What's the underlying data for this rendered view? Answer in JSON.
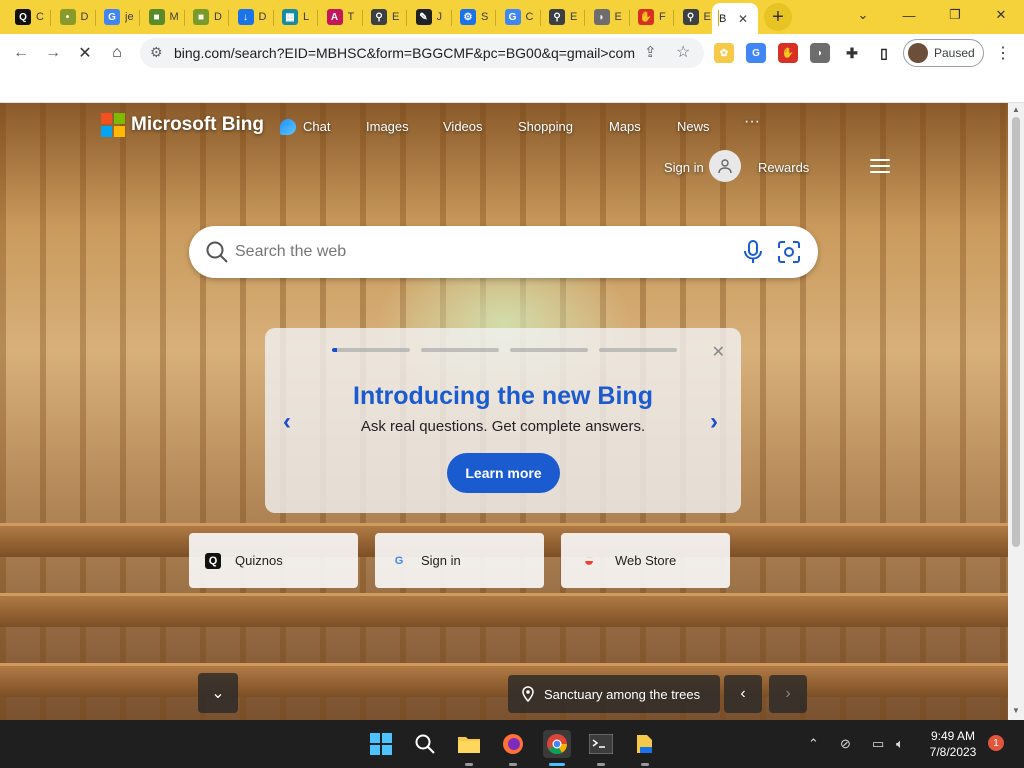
{
  "browser": {
    "tabs": [
      {
        "initial": "C",
        "icon": "quiznos-icon",
        "color": "#111111",
        "glyph": "Q"
      },
      {
        "initial": "D",
        "icon": "generic-icon",
        "color": "#8a9a2a",
        "glyph": "•"
      },
      {
        "initial": "je",
        "icon": "google-icon",
        "color": "#4285f4",
        "glyph": "G"
      },
      {
        "initial": "M",
        "icon": "cube-icon",
        "color": "#5a8a2a",
        "glyph": "■"
      },
      {
        "initial": "D",
        "icon": "cube-icon",
        "color": "#7a9a2a",
        "glyph": "■"
      },
      {
        "initial": "D",
        "icon": "download-icon",
        "color": "#1a73e8",
        "glyph": "↓"
      },
      {
        "initial": "L",
        "icon": "grid-icon",
        "color": "#1a8aa0",
        "glyph": "▦"
      },
      {
        "initial": "T",
        "icon": "a-icon",
        "color": "#c2185b",
        "glyph": "A"
      },
      {
        "initial": "E",
        "icon": "search-icon",
        "color": "#3c4043",
        "glyph": "⚲"
      },
      {
        "initial": "J",
        "icon": "ink-icon",
        "color": "#202124",
        "glyph": "✎"
      },
      {
        "initial": "S",
        "icon": "gear-icon",
        "color": "#1a73e8",
        "glyph": "⚙"
      },
      {
        "initial": "C",
        "icon": "google-icon",
        "color": "#4285f4",
        "glyph": "G"
      },
      {
        "initial": "E",
        "icon": "search-icon",
        "color": "#3c4043",
        "glyph": "⚲"
      },
      {
        "initial": "E",
        "icon": "shield-icon",
        "color": "#6d6d6d",
        "glyph": "◗"
      },
      {
        "initial": "F",
        "icon": "thumbs-icon",
        "color": "#d93025",
        "glyph": "✋"
      },
      {
        "initial": "E",
        "icon": "search-icon",
        "color": "#3c4043",
        "glyph": "⚲"
      }
    ],
    "active_tab": {
      "initial": "B",
      "close": "✕"
    },
    "new_tab": "+",
    "url": "bing.com/search?EID=MBHSC&form=BGGCMF&pc=BG00&q=gmail>com",
    "profile_status": "Paused"
  },
  "bing": {
    "logo_text": "Microsoft Bing",
    "nav": [
      "Chat",
      "Images",
      "Videos",
      "Shopping",
      "Maps",
      "News",
      "···"
    ],
    "sign_in": "Sign in",
    "rewards": "Rewards",
    "search_placeholder": "Search the web",
    "promo": {
      "title": "Introducing the new Bing",
      "subtitle": "Ask real questions. Get complete answers.",
      "button": "Learn more",
      "close": "✕",
      "prev": "‹",
      "next": "›"
    },
    "quick_links": [
      {
        "label": "Quiznos",
        "icon": "quiznos-icon",
        "glyph": "Q",
        "color": "#111111"
      },
      {
        "label": "Sign in",
        "icon": "google-icon",
        "glyph": "G",
        "color": "#4285f4"
      },
      {
        "label": "Web Store",
        "icon": "chrome-web-store-icon",
        "glyph": "◒",
        "color": "#ea4335"
      }
    ],
    "image_caption": "Sanctuary among the trees",
    "scroll_down": "⌄",
    "caption_prev": "‹",
    "caption_next": "›"
  },
  "taskbar": {
    "time": "9:49 AM",
    "date": "7/8/2023",
    "notifications": "1"
  },
  "colors": {
    "tabstrip": "#f5d23a",
    "bing_blue": "#1a5bd0",
    "taskbar": "#1f1f1f"
  }
}
